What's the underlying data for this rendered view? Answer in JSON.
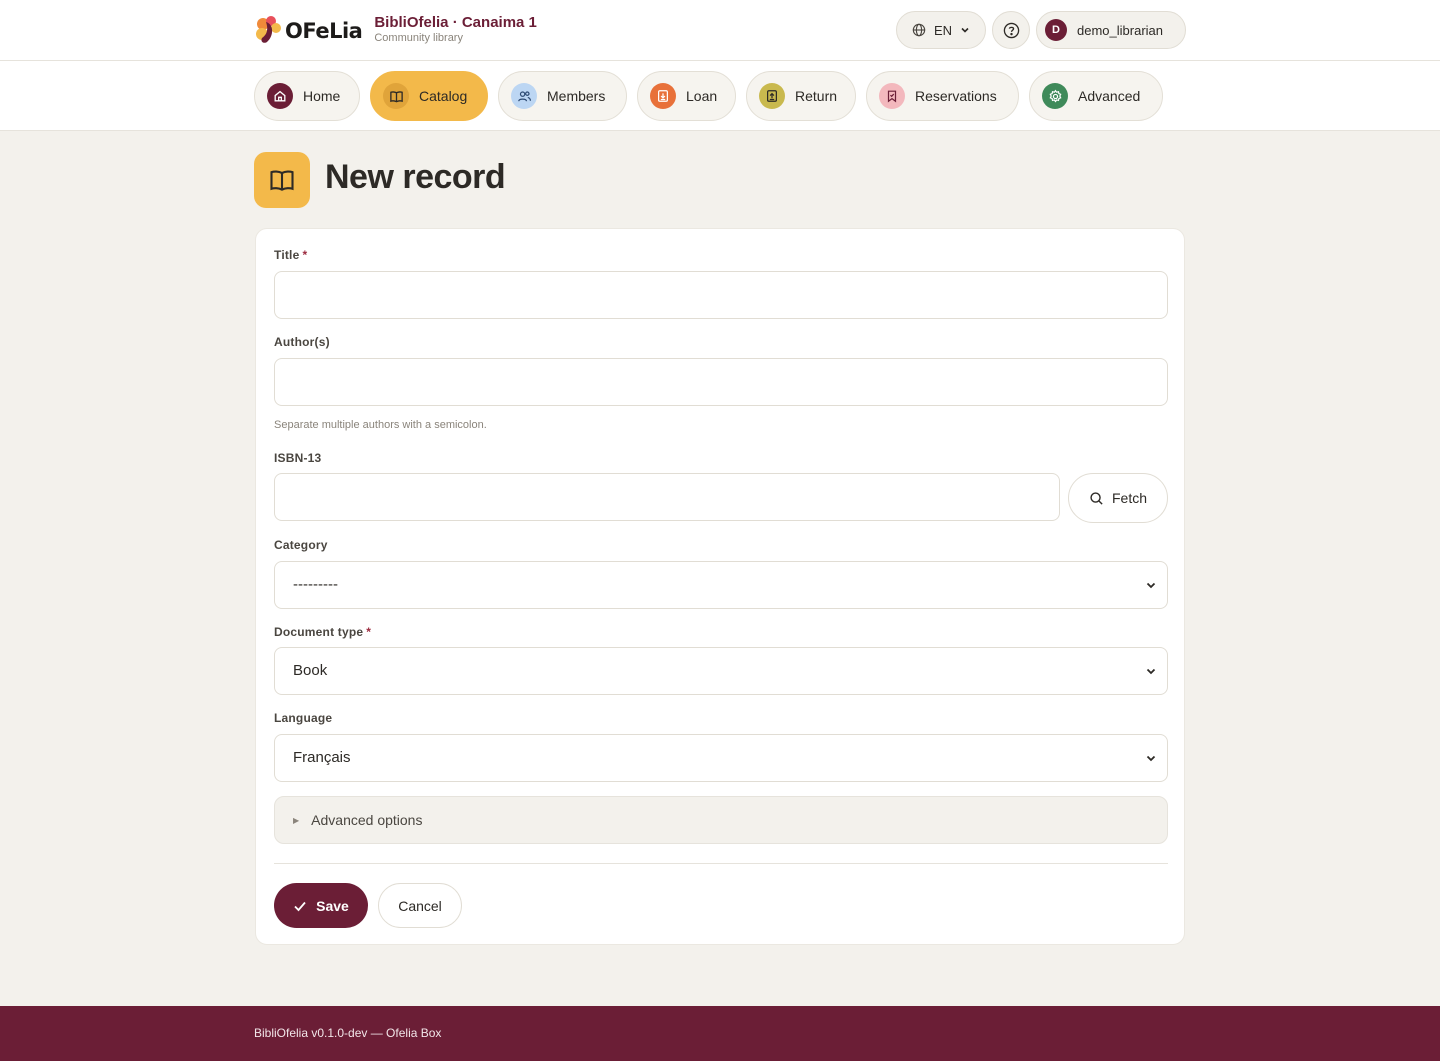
{
  "brand": {
    "logo_text": "OFeLia",
    "title": "BibliOfelia · Canaima 1",
    "subtitle": "Community library"
  },
  "header": {
    "language": "EN",
    "user_initial": "D",
    "username": "demo_librarian"
  },
  "nav": {
    "items": [
      {
        "label": "Home",
        "icon": "home-icon",
        "color": "#6b1e36"
      },
      {
        "label": "Catalog",
        "icon": "book-icon",
        "color": "#e0a43a",
        "active": true
      },
      {
        "label": "Members",
        "icon": "users-icon",
        "color": "#bcd6f3"
      },
      {
        "label": "Loan",
        "icon": "loan-icon",
        "color": "#e8713a"
      },
      {
        "label": "Return",
        "icon": "return-icon",
        "color": "#c9b94e"
      },
      {
        "label": "Reservations",
        "icon": "bookmark-icon",
        "color": "#f3b8bd"
      },
      {
        "label": "Advanced",
        "icon": "gear-icon",
        "color": "#3f8a5a"
      }
    ]
  },
  "page": {
    "title": "New record",
    "icon": "book-icon"
  },
  "form": {
    "title_label": "Title",
    "title_value": "",
    "authors_label": "Author(s)",
    "authors_value": "",
    "authors_help": "Separate multiple authors with a semicolon.",
    "isbn_label": "ISBN-13",
    "isbn_value": "",
    "fetch_label": "Fetch",
    "category_label": "Category",
    "category_value": "---------",
    "doctype_label": "Document type",
    "doctype_value": "Book",
    "language_label": "Language",
    "language_value": "Français",
    "advanced_label": "Advanced options",
    "required_mark": "*",
    "save_label": "Save",
    "cancel_label": "Cancel"
  },
  "footer": {
    "text": "BibliOfelia v0.1.0-dev — Ofelia Box"
  },
  "colors": {
    "brand": "#6b1e36",
    "accent": "#f3b94a",
    "background": "#f3f1ec"
  }
}
